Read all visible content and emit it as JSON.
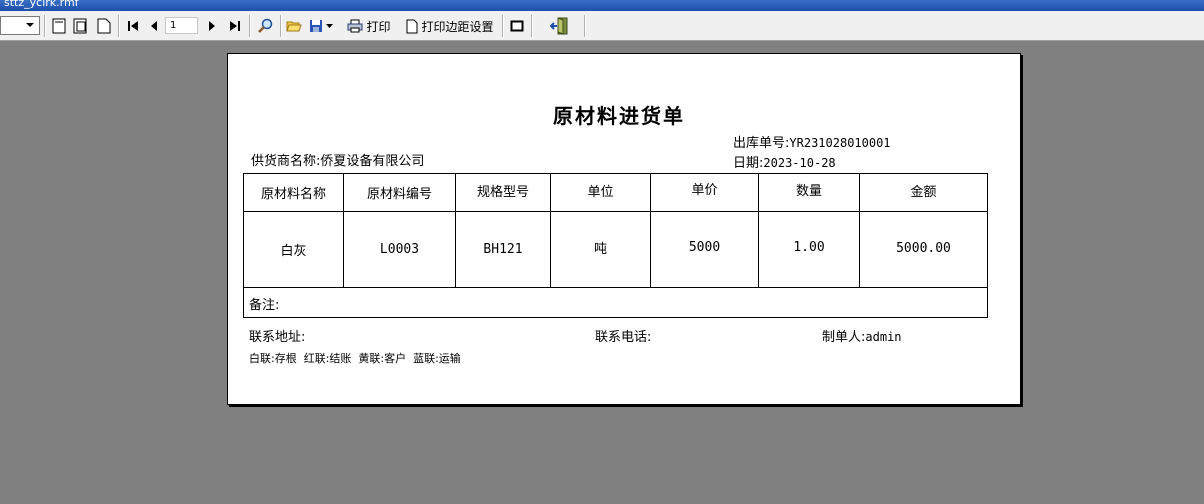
{
  "window": {
    "title": "sttz_yclrk.rmf"
  },
  "toolbar": {
    "page_number": "1",
    "print_label": "打印",
    "margin_settings_label": "打印边距设置"
  },
  "document": {
    "title": "原材料进货单",
    "order_no_label": "出库单号:",
    "order_no": "YR231028010001",
    "supplier_label": "供货商名称:",
    "supplier": "侨夏设备有限公司",
    "date_label": "日期:",
    "date": "2023-10-28",
    "columns": [
      "原材料名称",
      "原材料编号",
      "规格型号",
      "单位",
      "单价",
      "数量",
      "金额"
    ],
    "rows": [
      [
        "白灰",
        "L0003",
        "BH121",
        "吨",
        "5000",
        "1.00",
        "5000.00"
      ]
    ],
    "remark_label": "备注:",
    "address_label": "联系地址:",
    "phone_label": "联系电话:",
    "maker_label": "制单人:",
    "maker": "admin",
    "copies_note": "白联:存根  红联:结账  黄联:客户  蓝联:运输"
  }
}
